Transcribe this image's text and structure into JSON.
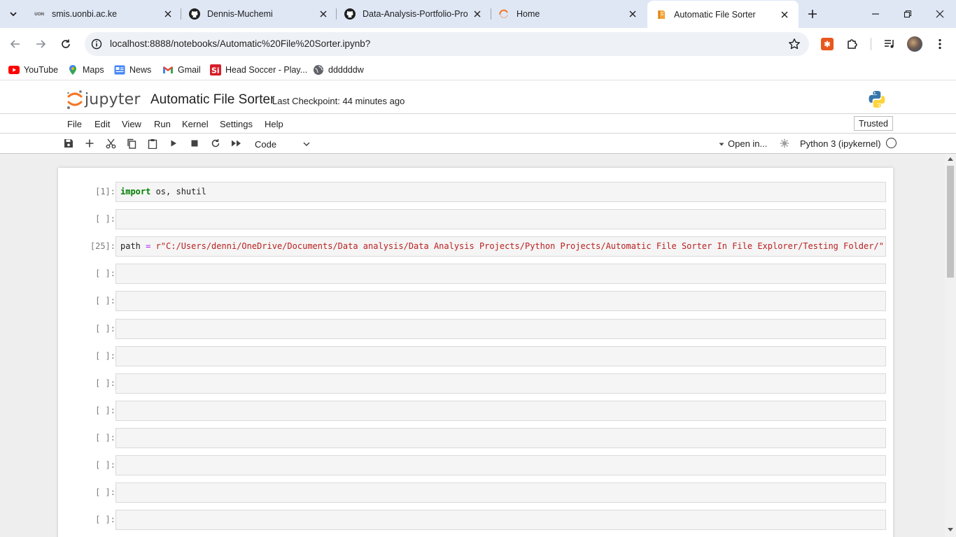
{
  "browser": {
    "tabs": [
      {
        "label": "smis.uonbi.ac.ke",
        "favicon_text": "UON",
        "icon": "uon-favicon"
      },
      {
        "label": "Dennis-Muchemi",
        "icon": "github-icon"
      },
      {
        "label": "Data-Analysis-Portfolio-Proj",
        "icon": "github-icon"
      },
      {
        "label": "Home",
        "icon": "jupyter-loading-icon"
      },
      {
        "label": "Automatic File Sorter",
        "icon": "notebook-icon",
        "active": true
      }
    ],
    "url": "localhost:8888/notebooks/Automatic%20File%20Sorter.ipynb?",
    "bookmarks": [
      {
        "label": "YouTube",
        "icon": "youtube-icon"
      },
      {
        "label": "Maps",
        "icon": "maps-icon"
      },
      {
        "label": "News",
        "icon": "news-icon"
      },
      {
        "label": "Gmail",
        "icon": "gmail-icon"
      },
      {
        "label": "Head Soccer - Play...",
        "icon": "head-soccer-icon"
      },
      {
        "label": "ddddddw",
        "icon": "globe-icon"
      }
    ]
  },
  "jupyter": {
    "logo_text": "jupyter",
    "notebook_title": "Automatic File Sorter",
    "checkpoint": "Last Checkpoint: 44 minutes ago",
    "menu": [
      "File",
      "Edit",
      "View",
      "Run",
      "Kernel",
      "Settings",
      "Help"
    ],
    "trusted": "Trusted",
    "cell_type": "Code",
    "open_in": "Open in...",
    "kernel": "Python 3 (ipykernel)",
    "cells": [
      {
        "prompt": "[1]:",
        "tokens": [
          {
            "t": "import",
            "c": "kw"
          },
          {
            "t": " os, shutil",
            "c": ""
          }
        ]
      },
      {
        "prompt": "[ ]:",
        "tokens": []
      },
      {
        "prompt": "[25]:",
        "tokens": [
          {
            "t": "path ",
            "c": ""
          },
          {
            "t": "=",
            "c": "op"
          },
          {
            "t": " r\"C:/Users/denni/OneDrive/Documents/Data analysis/Data Analysis Projects/Python Projects/Automatic File Sorter In File Explorer/Testing Folder/\"",
            "c": "str"
          }
        ]
      },
      {
        "prompt": "[ ]:",
        "tokens": []
      },
      {
        "prompt": "[ ]:",
        "tokens": []
      },
      {
        "prompt": "[ ]:",
        "tokens": []
      },
      {
        "prompt": "[ ]:",
        "tokens": []
      },
      {
        "prompt": "[ ]:",
        "tokens": []
      },
      {
        "prompt": "[ ]:",
        "tokens": []
      },
      {
        "prompt": "[ ]:",
        "tokens": []
      },
      {
        "prompt": "[ ]:",
        "tokens": []
      },
      {
        "prompt": "[ ]:",
        "tokens": []
      },
      {
        "prompt": "[ ]:",
        "tokens": []
      }
    ]
  },
  "colors": {
    "tabstrip": "#dfe7f5",
    "jupyter_orange": "#f37726",
    "keyword": "#008000",
    "operator": "#aa22ff",
    "string": "#ba2121"
  }
}
